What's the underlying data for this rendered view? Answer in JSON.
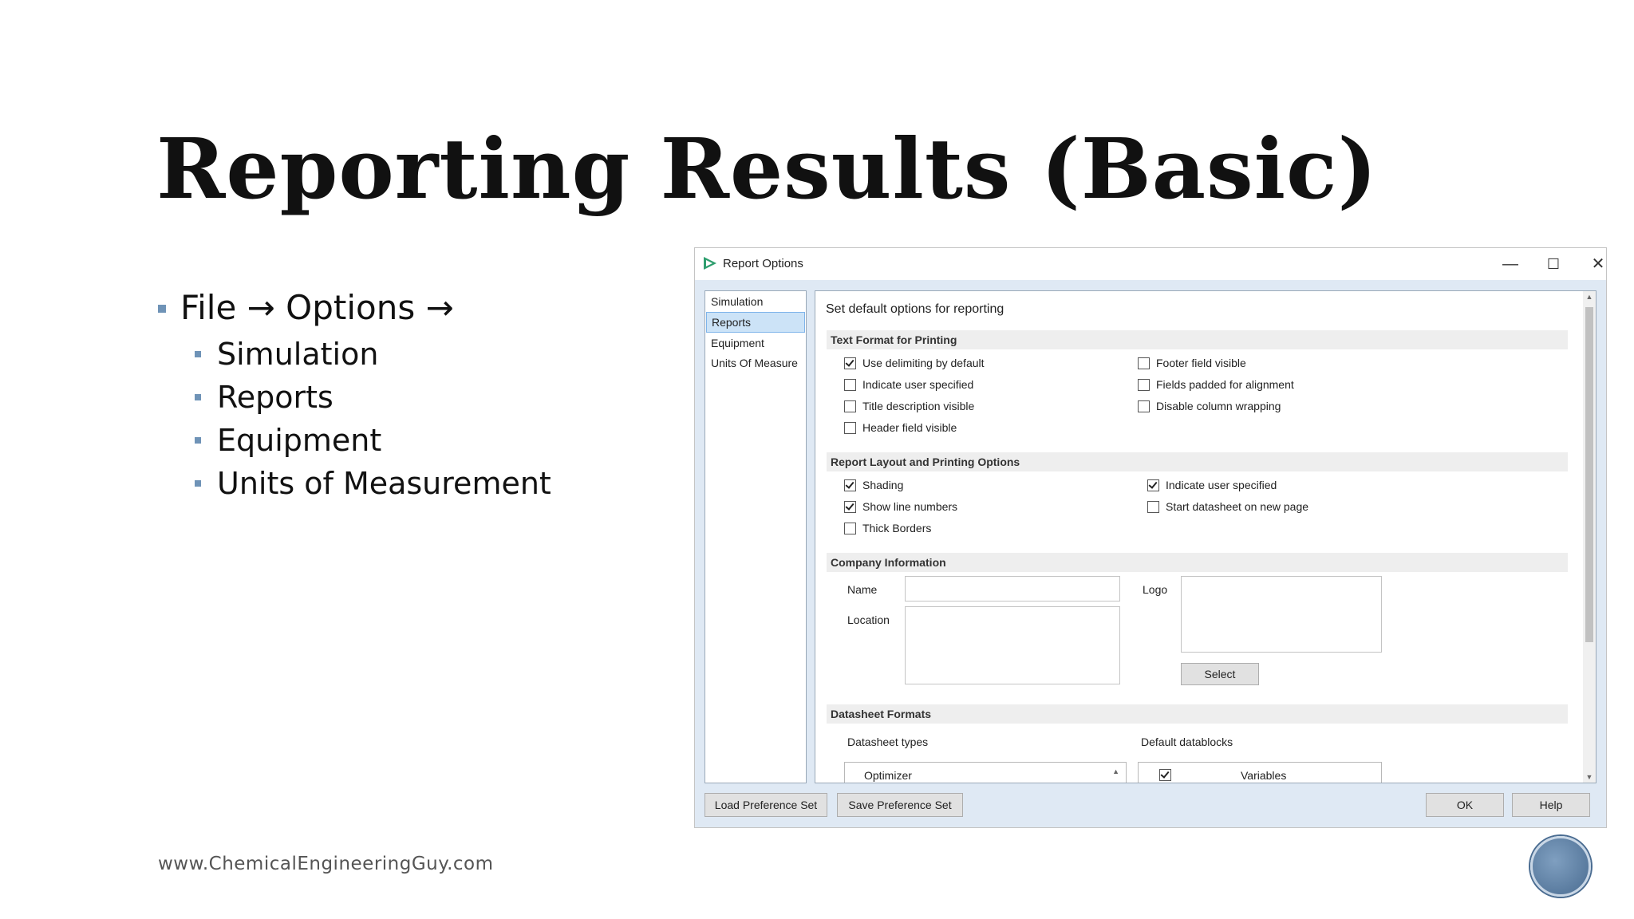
{
  "slide": {
    "title": "Reporting Results (Basic)",
    "bullet_main": "File → Options →",
    "sub_bullets": [
      "Simulation",
      "Reports",
      "Equipment",
      "Units of Measurement"
    ],
    "footer_url": "www.ChemicalEngineeringGuy.com"
  },
  "window": {
    "title": "Report Options",
    "controls": {
      "minimize": "—",
      "maximize": "☐",
      "close": "✕"
    }
  },
  "nav": {
    "items": [
      "Simulation",
      "Reports",
      "Equipment",
      "Units Of Measure"
    ],
    "selected": "Reports"
  },
  "content": {
    "intro": "Set default options for reporting",
    "text_format": {
      "header": "Text Format for Printing",
      "left": [
        {
          "label": "Use delimiting by default",
          "checked": true
        },
        {
          "label": "Indicate user specified",
          "checked": false
        },
        {
          "label": "Title description visible",
          "checked": false
        },
        {
          "label": "Header field visible",
          "checked": false
        }
      ],
      "right": [
        {
          "label": "Footer field visible",
          "checked": false
        },
        {
          "label": "Fields padded for alignment",
          "checked": false
        },
        {
          "label": "Disable column wrapping",
          "checked": false
        }
      ]
    },
    "layout": {
      "header": "Report Layout and Printing Options",
      "left": [
        {
          "label": "Shading",
          "checked": true
        },
        {
          "label": "Show line numbers",
          "checked": true
        },
        {
          "label": "Thick Borders",
          "checked": false
        }
      ],
      "right": [
        {
          "label": "Indicate user specified",
          "checked": true
        },
        {
          "label": "Start datasheet on new page",
          "checked": false
        }
      ]
    },
    "company": {
      "header": "Company Information",
      "name_label": "Name",
      "location_label": "Location",
      "logo_label": "Logo",
      "name_value": "",
      "location_value": "",
      "select_button": "Select"
    },
    "datasheet": {
      "header": "Datasheet Formats",
      "types_label": "Datasheet types",
      "datablocks_label": "Default datablocks",
      "type_value": "Optimizer",
      "datablock_value": "Variables",
      "datablock_checked": true
    }
  },
  "footer_buttons": {
    "load": "Load Preference Set",
    "save": "Save Preference Set",
    "ok": "OK",
    "help": "Help"
  },
  "colors": {
    "accent": "#6f93b7",
    "dialog_bg": "#dfe9f4",
    "selection": "#cce3f7"
  }
}
